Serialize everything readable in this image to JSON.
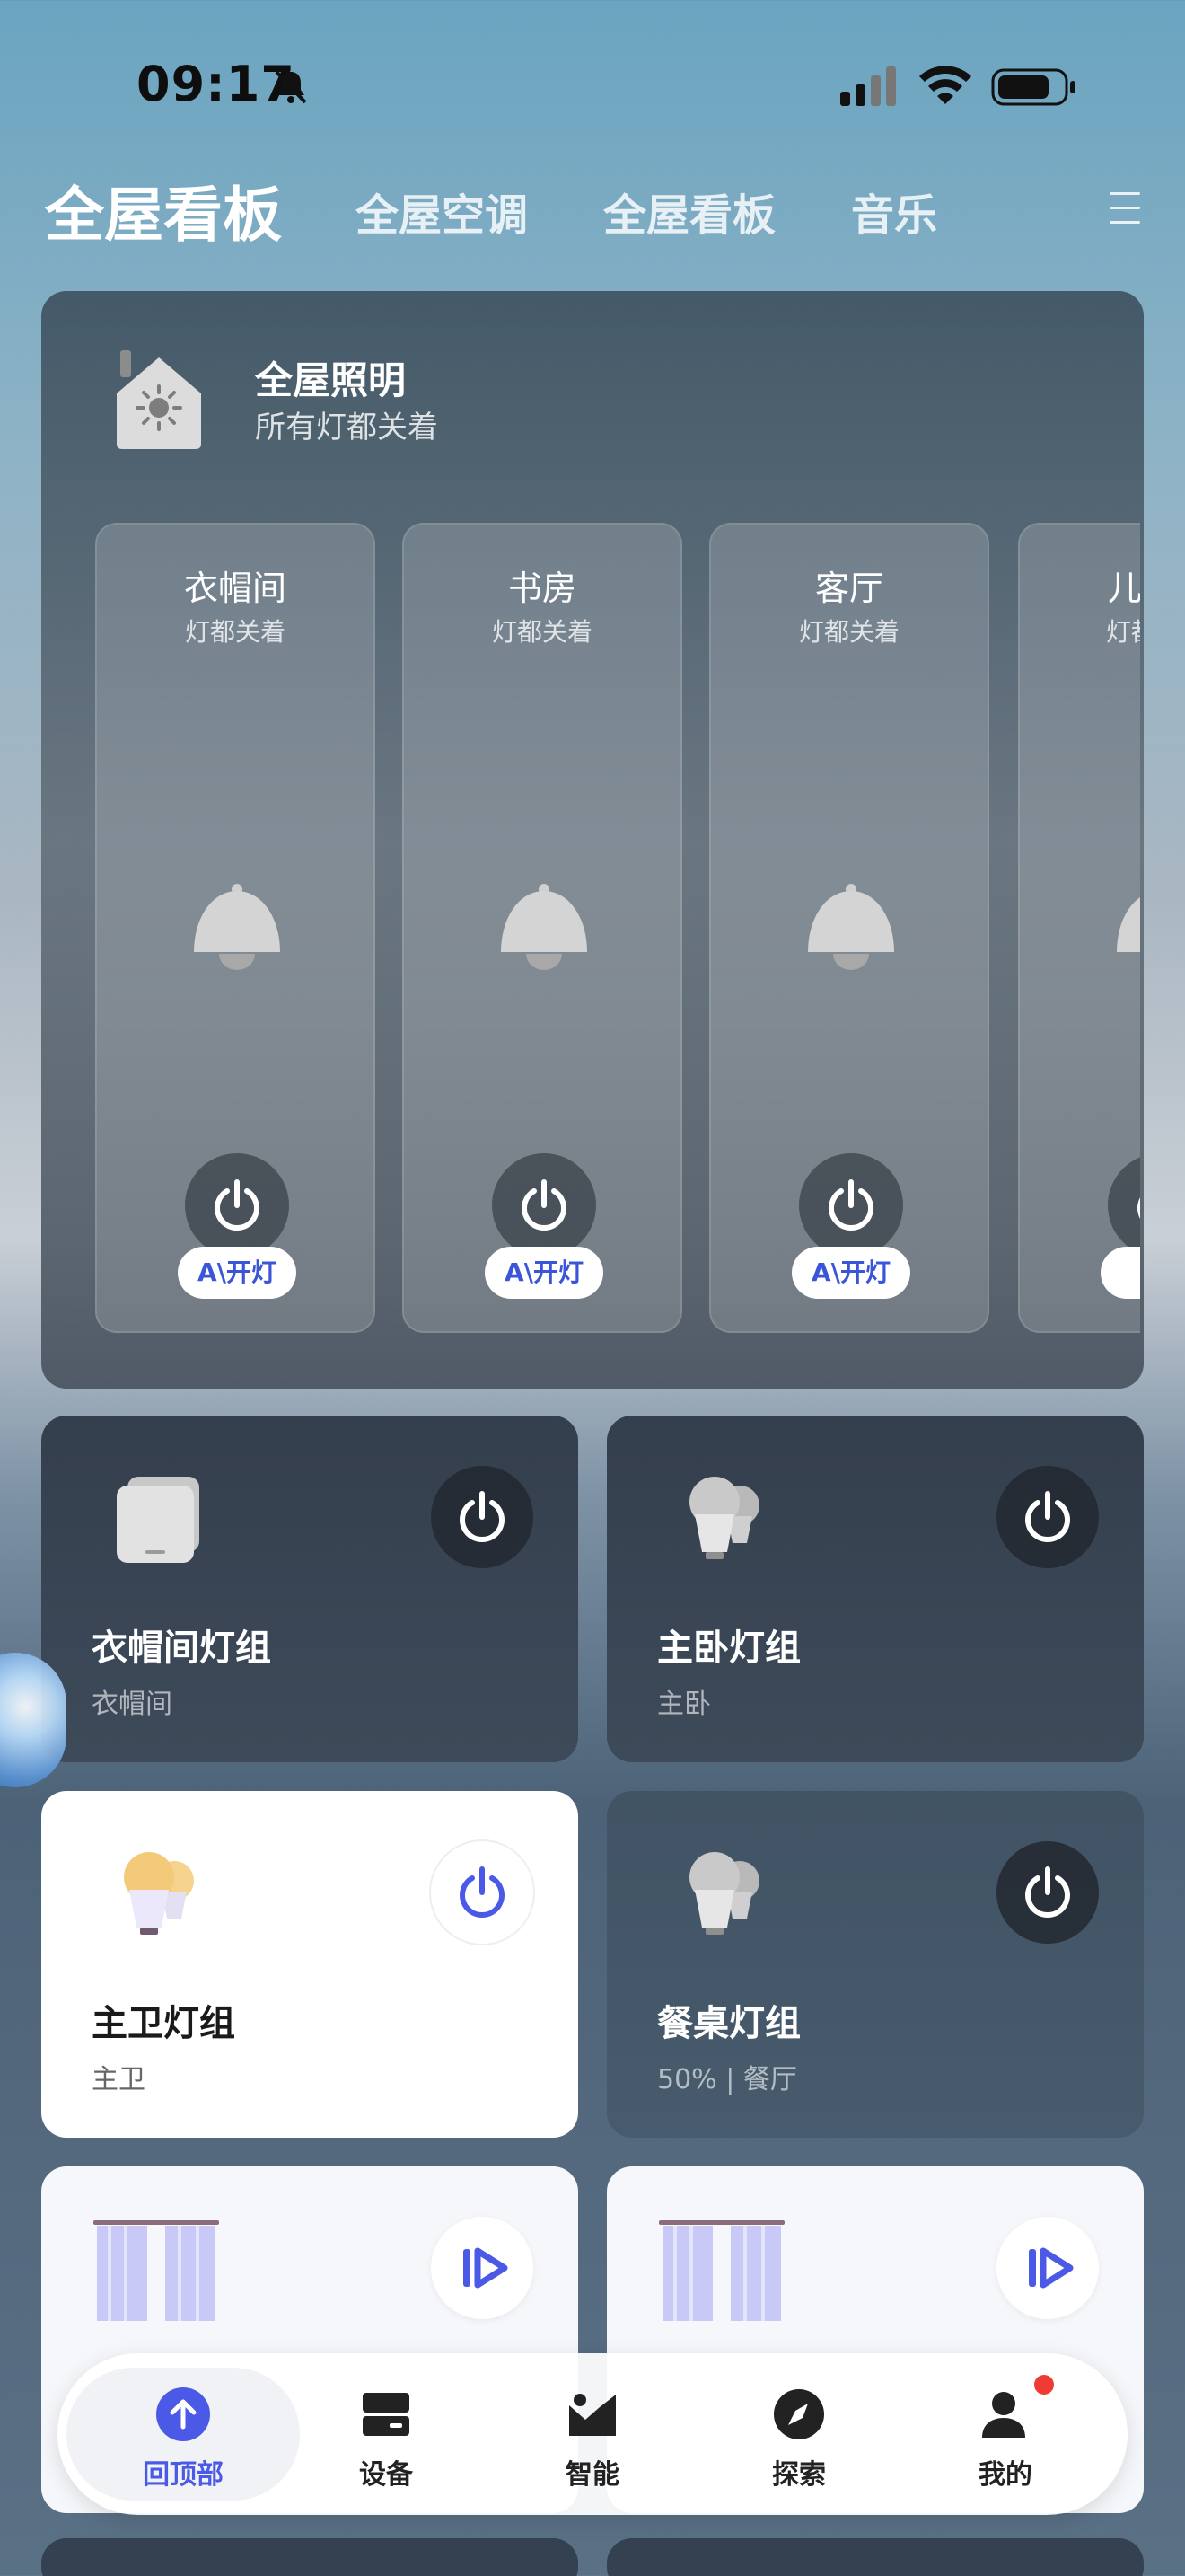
{
  "status_bar": {
    "time": "09:17"
  },
  "tabs": {
    "active": "全屋看板",
    "items": [
      "全屋空调",
      "全屋看板",
      "音乐"
    ]
  },
  "lighting": {
    "title": "全屋照明",
    "status": "所有灯都关着",
    "rooms": [
      {
        "name": "衣帽间",
        "status": "灯都关着",
        "ai_label": "A\\开灯"
      },
      {
        "name": "书房",
        "status": "灯都关着",
        "ai_label": "A\\开灯"
      },
      {
        "name": "客厅",
        "status": "灯都关着",
        "ai_label": "A\\开灯"
      },
      {
        "name": "儿",
        "status": "灯都",
        "ai_label": "A\\"
      }
    ]
  },
  "devices": [
    {
      "name": "衣帽间灯组",
      "sub": "衣帽间",
      "icon": "switch-panel-icon",
      "on": false
    },
    {
      "name": "主卧灯组",
      "sub": "主卧",
      "icon": "bulb-group-icon",
      "on": false
    },
    {
      "name": "主卫灯组",
      "sub": "主卫",
      "icon": "bulb-group-icon",
      "on": true
    },
    {
      "name": "餐桌灯组",
      "sub": "50% | 餐厅",
      "icon": "bulb-group-icon",
      "on": false
    }
  ],
  "curtains": [
    {
      "icon": "curtain-icon"
    },
    {
      "icon": "curtain-icon"
    }
  ],
  "bottom_nav": [
    {
      "label": "回顶部",
      "icon": "arrow-up-icon",
      "active": true
    },
    {
      "label": "设备",
      "icon": "device-icon",
      "active": false
    },
    {
      "label": "智能",
      "icon": "smart-scene-icon",
      "active": false
    },
    {
      "label": "探索",
      "icon": "compass-icon",
      "active": false
    },
    {
      "label": "我的",
      "icon": "profile-icon",
      "active": false,
      "badge": true
    }
  ],
  "colors": {
    "accent": "#4b5ae6",
    "badge": "#ef3b34"
  }
}
